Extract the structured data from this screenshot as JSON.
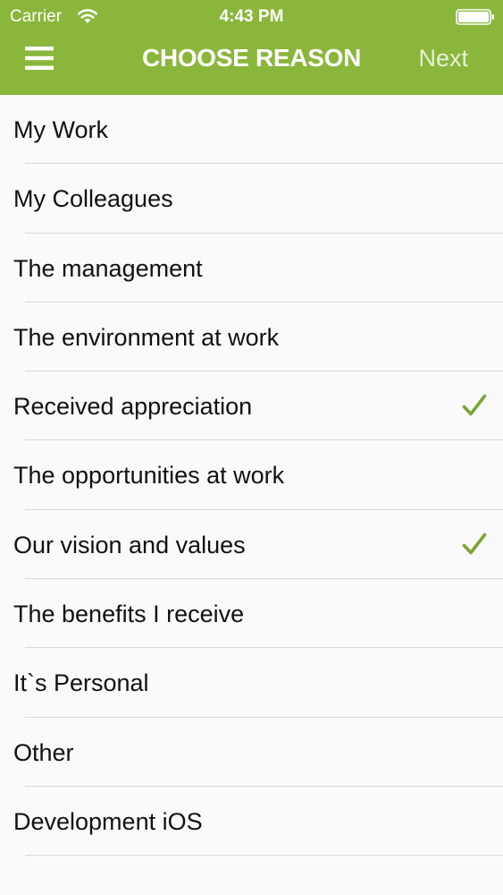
{
  "status_bar": {
    "carrier": "Carrier",
    "time": "4:43 PM"
  },
  "nav": {
    "title": "CHOOSE REASON",
    "next_label": "Next"
  },
  "colors": {
    "header_green": "#8ab63c",
    "checkmark_green": "#7aa431"
  },
  "reasons": [
    {
      "label": "My Work",
      "selected": false
    },
    {
      "label": "My Colleagues",
      "selected": false
    },
    {
      "label": "The management",
      "selected": false
    },
    {
      "label": "The environment at work",
      "selected": false
    },
    {
      "label": "Received appreciation",
      "selected": true
    },
    {
      "label": "The opportunities at work",
      "selected": false
    },
    {
      "label": "Our vision and values",
      "selected": true
    },
    {
      "label": "The benefits I receive",
      "selected": false
    },
    {
      "label": "It`s Personal",
      "selected": false
    },
    {
      "label": "Other",
      "selected": false
    },
    {
      "label": "Development iOS",
      "selected": false
    }
  ]
}
